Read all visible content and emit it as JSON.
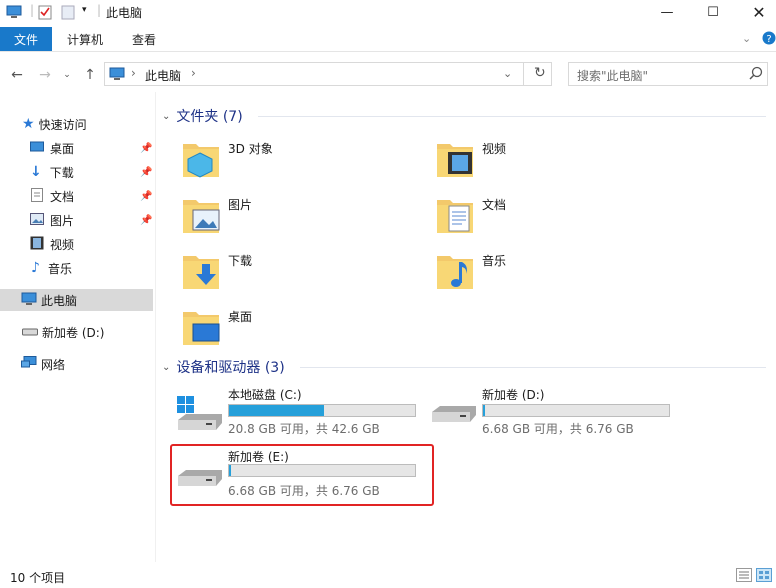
{
  "window": {
    "title": "此电脑"
  },
  "ribbon": {
    "tabs": [
      "文件",
      "计算机",
      "查看"
    ]
  },
  "address": {
    "path": "此电脑"
  },
  "search": {
    "placeholder": "搜索\"此电脑\""
  },
  "sidebar": {
    "quick_access": "快速访问",
    "items": [
      {
        "label": "桌面",
        "icon": "desktop-icon",
        "pinned": true
      },
      {
        "label": "下载",
        "icon": "download-icon",
        "pinned": true
      },
      {
        "label": "文档",
        "icon": "document-icon",
        "pinned": true
      },
      {
        "label": "图片",
        "icon": "picture-icon",
        "pinned": true
      },
      {
        "label": "视频",
        "icon": "video-icon",
        "pinned": false
      },
      {
        "label": "音乐",
        "icon": "music-icon",
        "pinned": false
      }
    ],
    "this_pc": "此电脑",
    "drive_d": "新加卷 (D:)",
    "network": "网络"
  },
  "folders_section": {
    "title": "文件夹 (7)"
  },
  "folders": [
    {
      "name": "3D 对象",
      "icon": "3d-objects-icon"
    },
    {
      "name": "视频",
      "icon": "video-folder-icon"
    },
    {
      "name": "图片",
      "icon": "pictures-folder-icon"
    },
    {
      "name": "文档",
      "icon": "documents-folder-icon"
    },
    {
      "name": "下载",
      "icon": "downloads-folder-icon"
    },
    {
      "name": "音乐",
      "icon": "music-folder-icon"
    },
    {
      "name": "桌面",
      "icon": "desktop-folder-icon"
    }
  ],
  "devices_section": {
    "title": "设备和驱动器 (3)"
  },
  "drives": [
    {
      "name": "本地磁盘 (C:)",
      "info": "20.8 GB 可用，共 42.6 GB",
      "used_fraction": 0.51
    },
    {
      "name": "新加卷 (D:)",
      "info": "6.68 GB 可用，共 6.76 GB",
      "used_fraction": 0.012
    },
    {
      "name": "新加卷 (E:)",
      "info": "6.68 GB 可用，共 6.76 GB",
      "used_fraction": 0.012
    }
  ],
  "status": {
    "count": "10 个项目"
  },
  "colors": {
    "accent": "#1979ca",
    "bar_fill": "#26a0da",
    "highlight": "#e12424",
    "folder": "#f8d775"
  }
}
